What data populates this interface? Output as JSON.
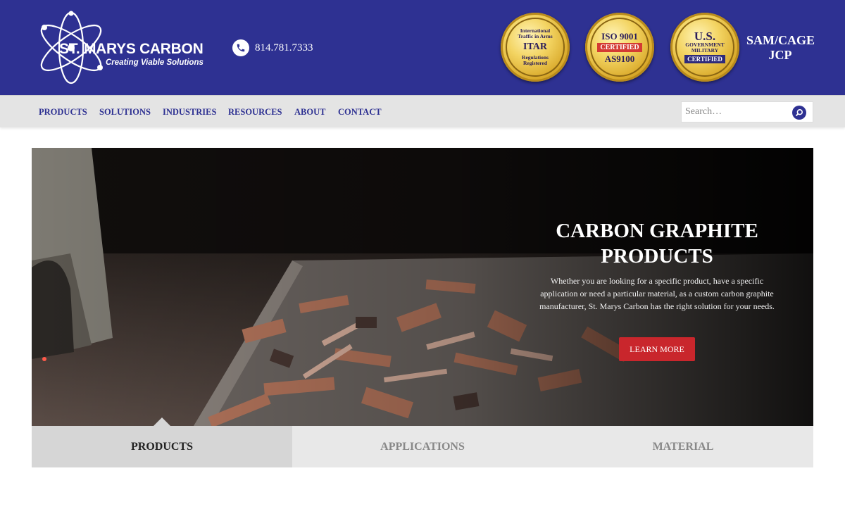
{
  "header": {
    "logo": {
      "name": "ST. MARYS CARBON",
      "tagline": "Creating Viable Solutions"
    },
    "phone": {
      "icon": "phone-icon",
      "number": "814.781.7333"
    },
    "badges": [
      {
        "top": "International Traffic in Arms",
        "main": "ITAR",
        "bottom": "Regulations Registered"
      },
      {
        "top": "ISO 9001",
        "main": "CERTIFIED",
        "bottom": "AS9100"
      },
      {
        "top": "U.S.",
        "main": "GOVERNMENT MILITARY",
        "bottom": "CERTIFIED"
      }
    ],
    "samcage": {
      "line1": "SAM/CAGE",
      "line2": "JCP"
    }
  },
  "nav": {
    "items": [
      "PRODUCTS",
      "SOLUTIONS",
      "INDUSTRIES",
      "RESOURCES",
      "ABOUT",
      "CONTACT"
    ],
    "search_placeholder": "Search…",
    "search_icon": "search-icon"
  },
  "hero": {
    "title_line1": "CARBON GRAPHITE",
    "title_line2": "PRODUCTS",
    "description": "Whether you are looking for a specific product, have a specific application or need a particular material, as a custom carbon graphite manufacturer, St. Marys Carbon has the right solution for your needs.",
    "button_label": "LEARN MORE"
  },
  "tabs": [
    {
      "label": "PRODUCTS",
      "active": true
    },
    {
      "label": "APPLICATIONS",
      "active": false
    },
    {
      "label": "MATERIAL",
      "active": false
    }
  ],
  "colors": {
    "brand": "#2e3192",
    "nav_bg": "#e4e4e4",
    "cta": "#c9262c"
  }
}
